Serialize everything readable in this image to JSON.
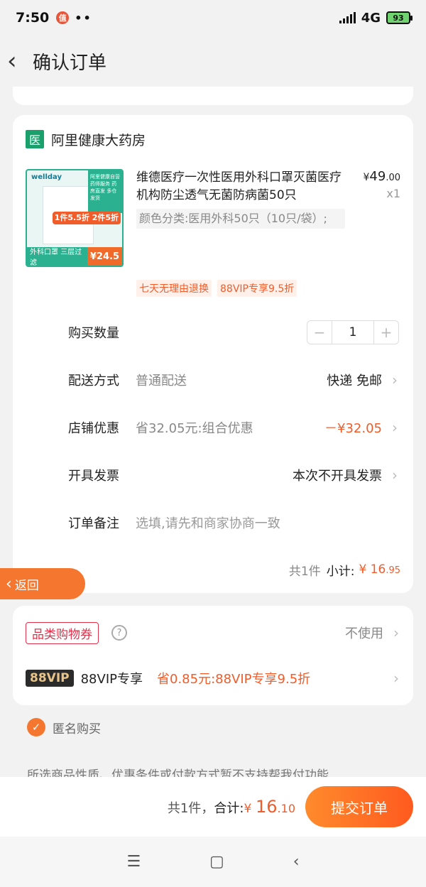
{
  "status": {
    "time": "7:50",
    "notif": "值",
    "dots": "••",
    "network": "4G",
    "battery": "93"
  },
  "nav": {
    "title": "确认订单"
  },
  "store": {
    "badge": "医",
    "name": "阿里健康大药房"
  },
  "product": {
    "thumb_brand": "wellday",
    "thumb_green": "阿里健康自营 药师服务 药房直发 多仓发货",
    "thumb_promo": "1件5.5折 2件5折",
    "thumb_bottom": "外科口罩 三层过滤",
    "thumb_price": "¥24.5",
    "title": "维德医疗一次性医用外科口罩灭菌医疗机构防尘透气无菌防病菌50只",
    "sku": "颜色分类:医用外科50只（10只/袋）;",
    "price_yen": "¥",
    "price_int": "49",
    "price_dec": ".00",
    "qty": "x1",
    "tags": [
      "七天无理由退换",
      "88VIP专享9.5折"
    ]
  },
  "rows": {
    "quantity_label": "购买数量",
    "quantity_value": "1",
    "delivery_label": "配送方式",
    "delivery_sub": "普通配送",
    "delivery_value": "快递 免邮",
    "discount_label": "店铺优惠",
    "discount_sub": "省32.05元:组合优惠",
    "discount_value": "－¥32.05",
    "invoice_label": "开具发票",
    "invoice_value": "本次不开具发票",
    "note_label": "订单备注",
    "note_placeholder": "选填,请先和商家协商一致"
  },
  "subtotal": {
    "count": "共1件",
    "label": "小计:",
    "yen": "¥",
    "int": "16",
    "dec": ".95"
  },
  "fab": {
    "label": "返回"
  },
  "coupons": {
    "coupon_label": "品类购物券",
    "coupon_value": "不使用",
    "vip_badge": "88VIP",
    "vip_label": "88VIP专享",
    "vip_desc": "省0.85元:88VIP专享9.5折"
  },
  "anon": {
    "label": "匿名购买"
  },
  "notice": "所选商品性质、优惠条件或付款方式暂不支持帮我付功能",
  "footer": {
    "count": "共1件，",
    "label": "合计:",
    "yen": "¥",
    "int": "16",
    "dec": ".10",
    "submit": "提交订单"
  },
  "colors": {
    "accent": "#f05c2a",
    "store_badge": "#1aa06b",
    "vip_gold": "#e8c488"
  }
}
